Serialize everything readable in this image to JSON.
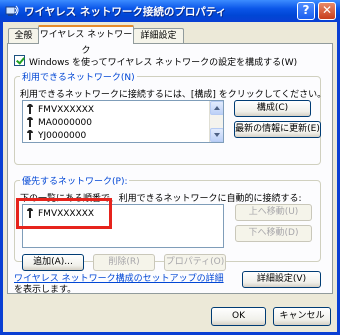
{
  "window": {
    "title": "ワイヤレス ネットワーク接続のプロパティ",
    "help_label": "?",
    "close_label": "✕"
  },
  "tabs": [
    {
      "label": "全般"
    },
    {
      "label": "ワイヤレス ネットワーク"
    },
    {
      "label": "詳細設定"
    }
  ],
  "use_windows_checkbox": {
    "label": "Windows を使ってワイヤレス ネットワークの設定を構成する(W)",
    "checked": true
  },
  "available_networks": {
    "group_label": "利用できるネットワーク(N)",
    "instruction": "利用できるネットワークに接続するには、[構成] をクリックしてください。",
    "items": [
      "FMVXXXXXX",
      "MA0000000",
      "YJ0000000"
    ],
    "configure_button": "構成(C)",
    "refresh_button": "最新の情報に更新(E)"
  },
  "preferred_networks": {
    "group_label": "優先するネットワーク(P):",
    "instruction": "下の一覧にある順番で、利用できるネットワークに自動的に接続する:",
    "items": [
      "FMVXXXXXX"
    ],
    "move_up_button": "上へ移動(U)",
    "move_down_button": "下へ移動(D)",
    "add_button": "追加(A)...",
    "remove_button": "削除(R)",
    "properties_button": "プロパティ(O)"
  },
  "setup_link": {
    "line1": "ワイヤレス ネットワーク構成のセットアップの詳細",
    "line2": "を表示します。"
  },
  "advanced_button": "詳細設定(V)",
  "footer": {
    "ok_button": "OK",
    "cancel_button": "キャンセル"
  },
  "colors": {
    "title_bar": "#0a3fd3",
    "dialog_face": "#ece9d8",
    "link": "#0046d5",
    "highlight_box": "#e6231c"
  }
}
